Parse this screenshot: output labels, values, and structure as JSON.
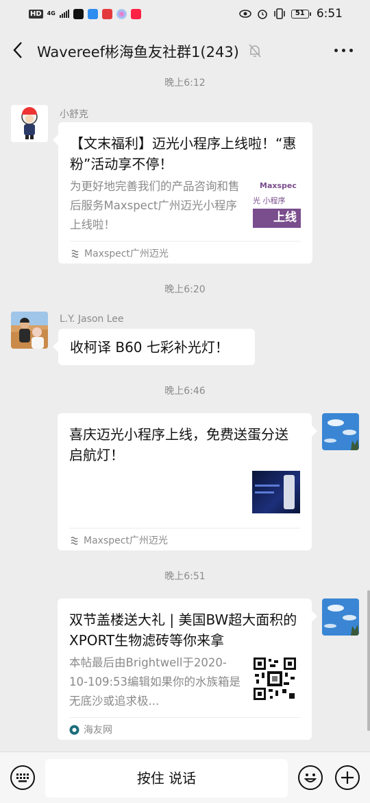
{
  "status_bar": {
    "hd": "HD",
    "network": "4G",
    "time": "6:51",
    "battery": "51"
  },
  "nav": {
    "title": "Wavereef彬海鱼友社群1(243)"
  },
  "messages": {
    "ts1": "晚上6:12",
    "m1": {
      "sender": "小舒克",
      "title": "【文末福利】迈光小程序上线啦！“惠粉”活动享不停！",
      "desc": "为更好地完善我们的产品咨询和售后服务Maxspect广州迈光小程序上线啦！",
      "source": "Maxspect广州迈光",
      "thumb_text1": "Maxspec",
      "thumb_text2": "光 小程序",
      "thumb_text3": "上线"
    },
    "ts2": "晚上6:20",
    "m2": {
      "sender": "L.Y. Jason Lee",
      "text": "收柯译 B60 七彩补光灯！"
    },
    "ts3": "晚上6:46",
    "m3": {
      "title": "喜庆迈光小程序上线，免费送蛋分送启航灯！",
      "source": "Maxspect广州迈光"
    },
    "ts4": "晚上6:51",
    "m4": {
      "title": "双节盖楼送大礼 | 美国BW超大面积的XPORT生物滤砖等你来拿",
      "desc": "本帖最后由Brightwell于2020-10-109:53编辑如果你的水族箱是无底沙或追求极...",
      "source": "海友网"
    }
  },
  "input_bar": {
    "hold_to_talk": "按住 说话"
  },
  "icons": {
    "back": "chevron-left-icon",
    "mute": "bell-off-icon",
    "more": "more-dots-icon",
    "keyboard": "keyboard-icon",
    "emoji": "emoji-icon",
    "plus": "plus-icon"
  },
  "colors": {
    "background": "#ededed",
    "bubble": "#ffffff",
    "muted_text": "#8a8a8a",
    "maxspect_purple": "#7a4d8d"
  }
}
